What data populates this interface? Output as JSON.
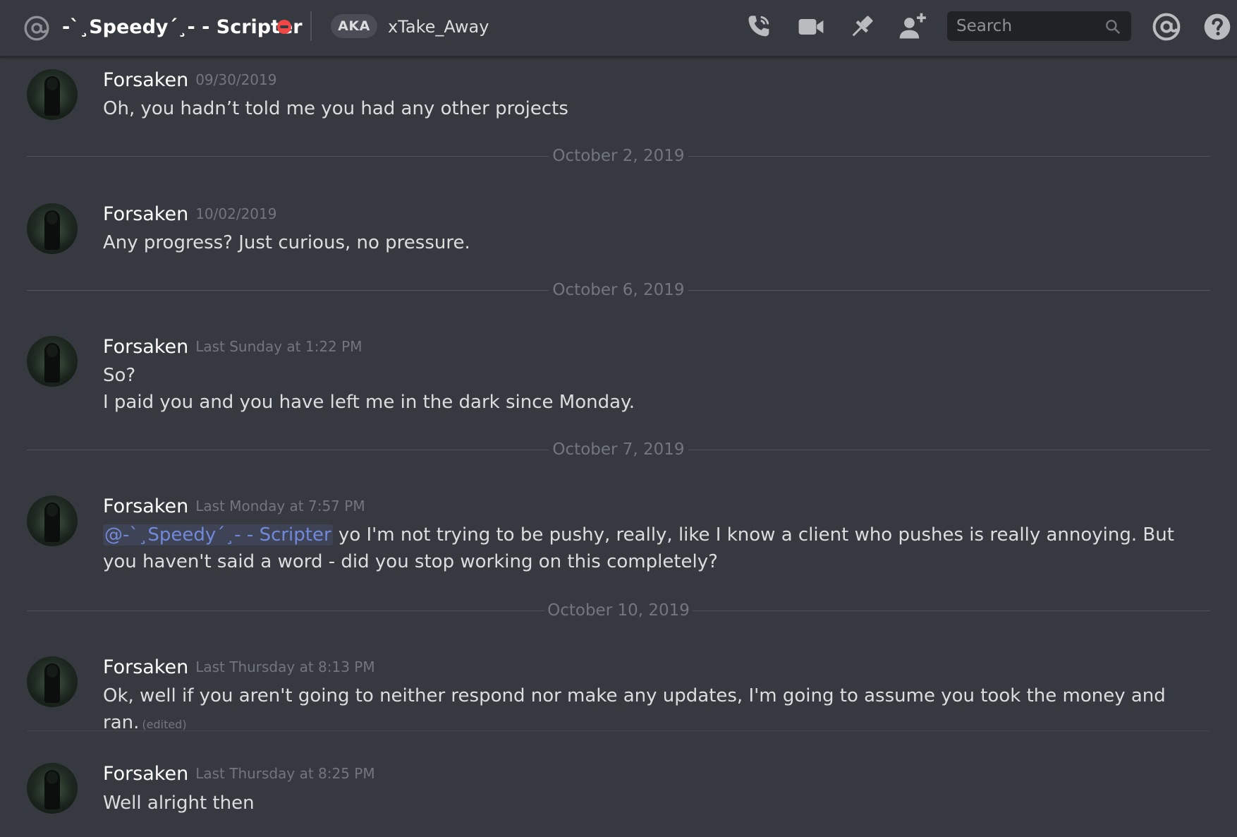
{
  "header": {
    "dm_name": "-`¸Speedy´¸- - Scripter",
    "status": "do-not-disturb",
    "aka_label": "AKA",
    "aka_name": "xTake_Away",
    "icons": [
      "at-icon",
      "voice-call-icon",
      "video-call-icon",
      "pin-icon",
      "add-friend-icon",
      "mentions-icon",
      "help-icon"
    ],
    "search": {
      "placeholder": "Search",
      "value": ""
    }
  },
  "messages": [
    {
      "author": "Forsaken",
      "timestamp": "09/30/2019",
      "lines": [
        "Oh, you hadn’t told me you had any other projects"
      ]
    },
    {
      "divider": "October 2, 2019"
    },
    {
      "author": "Forsaken",
      "timestamp": "10/02/2019",
      "lines": [
        "Any progress? Just curious, no pressure."
      ]
    },
    {
      "divider": "October 6, 2019"
    },
    {
      "author": "Forsaken",
      "timestamp": "Last Sunday at 1:22 PM",
      "lines": [
        "So?",
        "I paid you and you have left me in the dark since Monday."
      ]
    },
    {
      "divider": "October 7, 2019"
    },
    {
      "author": "Forsaken",
      "timestamp": "Last Monday at 7:57 PM",
      "mention": "@-`¸Speedy´¸- - Scripter",
      "text": " yo I'm not trying to be pushy, really, like I know a client who pushes is really annoying. But you haven't said a word - did you stop working on this completely?"
    },
    {
      "divider": "October 10, 2019"
    },
    {
      "author": "Forsaken",
      "timestamp": "Last Thursday at 8:13 PM",
      "text": "Ok, well if you aren't going to neither respond nor make any updates, I'm going to assume you took the money and ran.",
      "edited": "(edited)"
    },
    {
      "author": "Forsaken",
      "timestamp": "Last Thursday at 8:25 PM",
      "lines": [
        "Well alright then"
      ]
    }
  ],
  "colors": {
    "background": "#36393f",
    "mention": "#7289da",
    "dnd": "#f04747",
    "timestamp": "#72767d"
  }
}
